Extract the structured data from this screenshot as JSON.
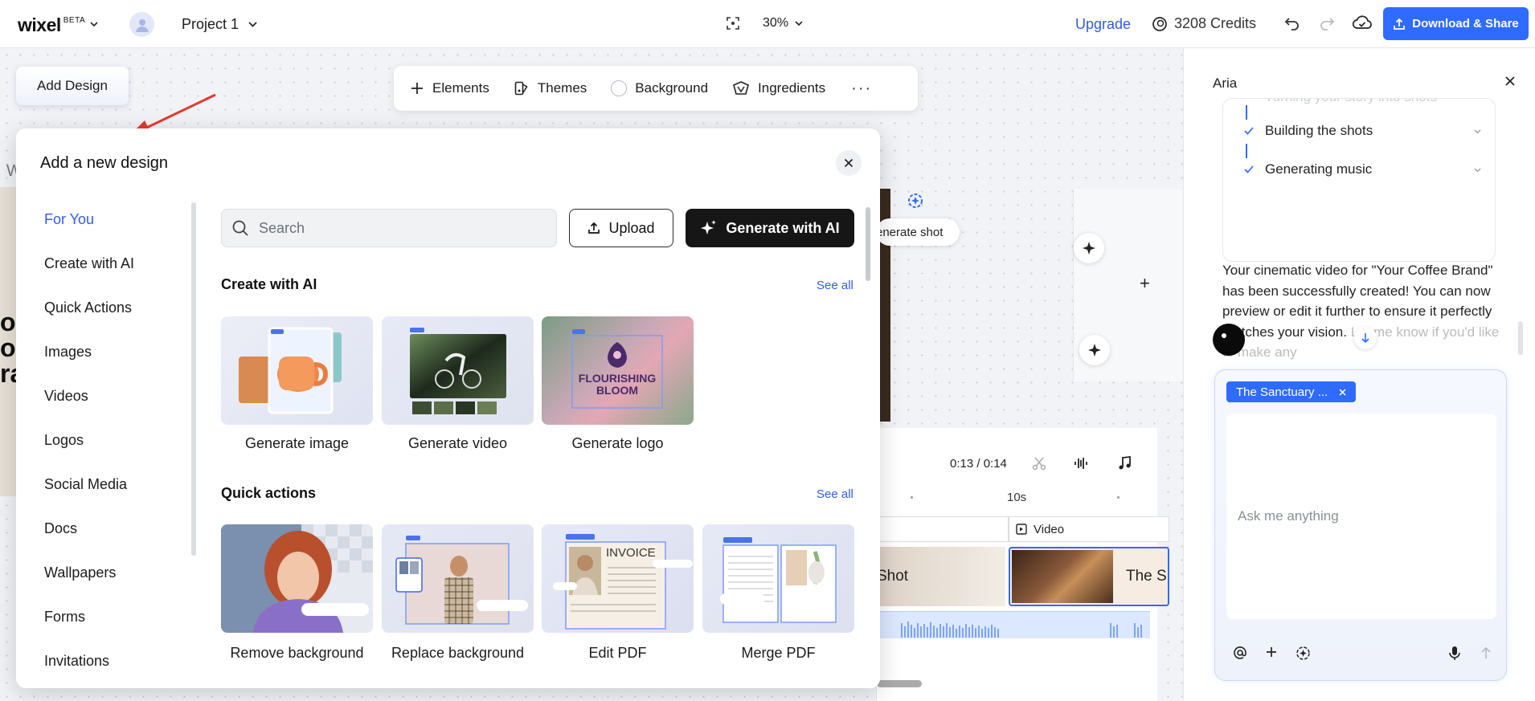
{
  "topbar": {
    "logo": "wixel",
    "logo_badge": "BETA",
    "project": "Project 1",
    "zoom": "30%",
    "upgrade": "Upgrade",
    "credits": "3208 Credits",
    "download": "Download & Share"
  },
  "canvas": {
    "add_design": "Add Design",
    "toolbar": {
      "elements": "Elements",
      "themes": "Themes",
      "background": "Background",
      "ingredients": "Ingredients",
      "more": "···"
    },
    "generate_shot": "enerate shot",
    "left_text": "ou\nof\nra",
    "left_letter": "W",
    "timeline": {
      "time": "0:13 / 0:14",
      "marker": "10s",
      "video_label": "Video",
      "shot_label": "Shot",
      "shot2_label": "The S"
    }
  },
  "modal": {
    "title": "Add a new design",
    "sidebar": [
      "For You",
      "Create with AI",
      "Quick Actions",
      "Images",
      "Videos",
      "Logos",
      "Social Media",
      "Docs",
      "Wallpapers",
      "Forms",
      "Invitations"
    ],
    "active_index": 0,
    "search_placeholder": "Search",
    "upload": "Upload",
    "generate": "Generate with AI",
    "create_section": {
      "title": "Create with AI",
      "see_all": "See all",
      "items": [
        "Generate image",
        "Generate video",
        "Generate logo"
      ]
    },
    "quick_section": {
      "title": "Quick actions",
      "see_all": "See all",
      "items": [
        "Remove background",
        "Replace background",
        "Edit PDF",
        "Merge PDF"
      ]
    },
    "logo_art": [
      "FLOURISHING",
      "BLOOM"
    ],
    "invoice_art": "INVOICE"
  },
  "aria": {
    "title": "Aria",
    "steps_faded": "Turning your story into shots",
    "steps": [
      "Building the shots",
      "Generating music"
    ],
    "message": "Your cinematic video for \"Your Coffee Brand\" has been successfully created! You can now preview or edit it further to ensure it perfectly matches your vision.",
    "message_fade": "Let me know if you'd like to make any",
    "chip": "The Sanctuary ...",
    "input_placeholder": "Ask me anything"
  },
  "colors": {
    "accent": "#2f6bff",
    "link": "#2f5bea",
    "dark_button": "#161616"
  }
}
